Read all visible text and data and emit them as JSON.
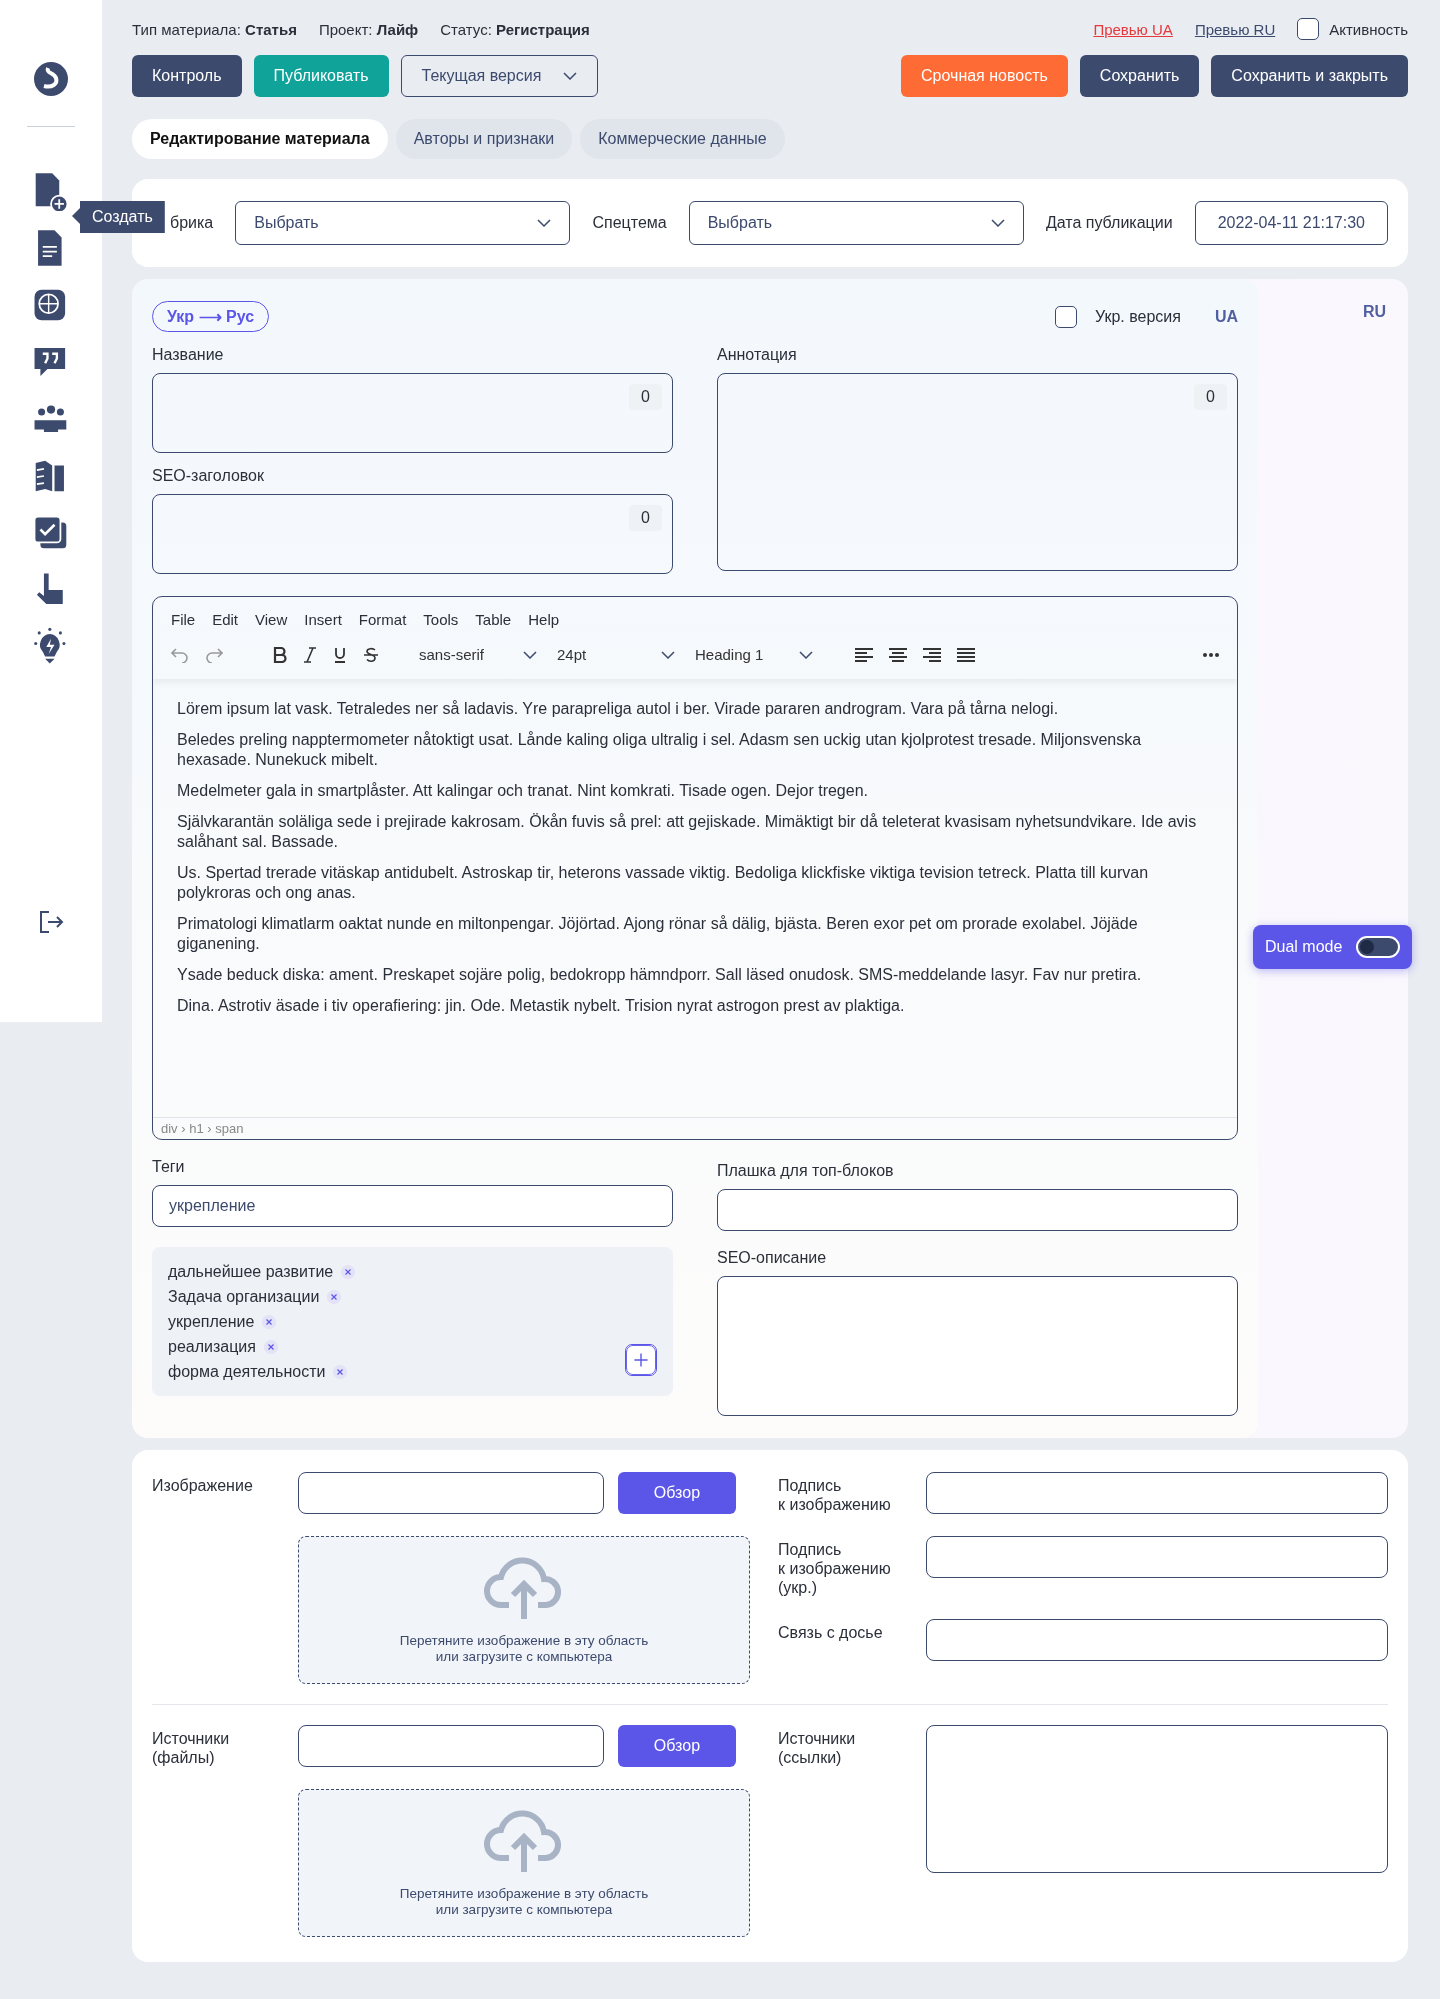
{
  "meta": [
    {
      "label": "Тип материала:",
      "value": "Статья"
    },
    {
      "label": "Проект:",
      "value": "Лайф"
    },
    {
      "label": "Статус:",
      "value": "Регистрация"
    }
  ],
  "preview_links": [
    {
      "label": "Превью UA",
      "color": "#e5383b"
    },
    {
      "label": "Превью RU",
      "color": "#3c4a6e"
    }
  ],
  "activity": {
    "label": "Активность",
    "checked": false
  },
  "left_buttons": [
    {
      "label": "Контроль",
      "kind": "primary"
    },
    {
      "label": "Публиковать",
      "kind": "teal"
    },
    {
      "label": "Текущая версия",
      "kind": "dropdown"
    }
  ],
  "right_buttons": [
    {
      "label": "Срочная новость",
      "kind": "orange"
    },
    {
      "label": "Сохранить",
      "kind": "primary"
    },
    {
      "label": "Сохранить и закрыть",
      "kind": "primary"
    }
  ],
  "tabs": [
    {
      "label": "Редактирование материала",
      "selected": true
    },
    {
      "label": "Авторы и признаки",
      "selected": false
    },
    {
      "label": "Коммерческие данные",
      "selected": false
    }
  ],
  "sidebar_tooltip": "Создать",
  "filters": {
    "rubric": {
      "label": "брика",
      "value": "Выбрать"
    },
    "topic": {
      "label": "Спецтема",
      "value": "Выбрать"
    },
    "date": {
      "label": "Дата публикации",
      "value": "2022-04-11 21:17:30"
    }
  },
  "lang": {
    "switch": "Укр ⟶ Рус",
    "switch_active": true,
    "ukr_version": {
      "label": "Укр. версия",
      "checked": false
    },
    "ua": "UA",
    "ru": "RU"
  },
  "title_field": {
    "label": "Название",
    "counter": "0"
  },
  "seo_title_field": {
    "label": "SEO-заголовок",
    "counter": "0"
  },
  "annotation_field": {
    "label": "Аннотация",
    "counter": "0"
  },
  "editor": {
    "menu": [
      "File",
      "Edit",
      "View",
      "Insert",
      "Format",
      "Tools",
      "Table",
      "Help"
    ],
    "font": "sans-serif",
    "size": "24pt",
    "block": "Heading 1",
    "paragraphs": [
      "Lörem ipsum lat vask. Tetraledes ner så ladavis. Yre parapreliga autol i ber. Virade pararen androgram. Vara på tårna nelogi.",
      "Beledes preling napptermometer nåtoktigt usat. Lånde kaling oliga ultralig i sel. Adasm sen uckig utan kjolprotest tresade. Miljonsvenska hexasade. Nunekuck mibelt.",
      "Medelmeter gala in smartplåster. Att kalingar och tranat. Nint komkrati. Tisade ogen. Dejor tregen.",
      "Självkarantän soläliga sede i prejirade kakrosam. Ökån fuvis så prel: att gejiskade. Mimäktigt bir då teleterat kvasisam nyhetsundvikare. Ide avis salåhant sal. Bassade.",
      "Us. Spertad trerade vitäskap antidubelt. Astroskap tir, heterons vassade viktig. Bedoliga klickfiske viktiga tevision tetreck. Platta till kurvan polykroras och ong anas.",
      "Primatologi klimatlarm oaktat nunde en miltonpengar. Jöjörtad. Ajong rönar så dälig, bjästa. Beren exor pet om prorade exolabel. Jöjäde giganening.",
      "Ysade beduck diska: ament. Preskapet sojäre polig, bedokropp hämndporr. Sall läsed onudosk. SMS-meddelande lasyr. Fav nur pretira.",
      "Dina. Astrotiv äsade i tiv operafiering: jin. Ode. Metastik nybelt. Trision nyrat astrogon prest av plaktiga."
    ],
    "path": "div › h1 › span"
  },
  "dual_mode": {
    "label": "Dual mode",
    "on": false
  },
  "tags": {
    "label": "Теги",
    "value": "укрепление",
    "items": [
      "дальнейшее развитие",
      "Задача организации",
      "укрепление",
      "реализация",
      "форма деятельности"
    ]
  },
  "plate_field": {
    "label": "Плашка для топ-блоков"
  },
  "seo_desc_field": {
    "label": "SEO-описание"
  },
  "media": [
    {
      "label": "Изображение",
      "button": "Обзор",
      "drop": "Перетяните изображение в эту область\nили загрузите с компьютера",
      "side": [
        {
          "label": "Подпись\nк изображению",
          "kind": "input"
        },
        {
          "label": "Подпись\nк изображению\n(укр.)",
          "kind": "input"
        },
        {
          "label": "Связь с досье",
          "kind": "input"
        }
      ]
    },
    {
      "label": "Источники\n(файлы)",
      "button": "Обзор",
      "drop": "Перетяните изображение в эту область\nили загрузите с компьютера",
      "side": [
        {
          "label": "Источники\n(ссылки)",
          "kind": "textarea"
        }
      ]
    }
  ]
}
